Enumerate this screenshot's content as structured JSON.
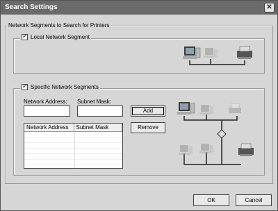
{
  "window": {
    "title": "Search Settings"
  },
  "main_group": {
    "title": "Network Segments to Search for Printers"
  },
  "local": {
    "label": "Local Network Segment",
    "checked": true
  },
  "specific": {
    "label": "Specific Network Segments",
    "checked": true,
    "network_address_label": "Network Address:",
    "subnet_mask_label": "Subnet Mask:",
    "network_address_value": "",
    "subnet_mask_value": "",
    "add_label": "Add",
    "remove_label": "Remove",
    "columns": [
      "Network Address",
      "Subnet Mask"
    ]
  },
  "buttons": {
    "ok": "OK",
    "cancel": "Cancel"
  },
  "icons": {
    "close": "close-icon",
    "computer": "computer-icon",
    "printer": "printer-icon",
    "router": "router-icon"
  }
}
